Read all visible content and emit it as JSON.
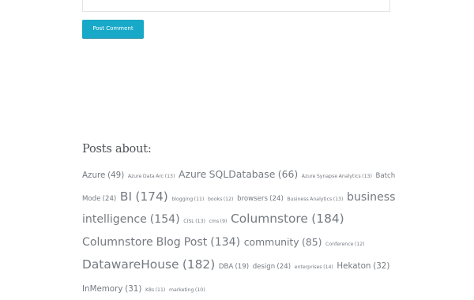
{
  "comment_form": {
    "submit_label": "Post Comment"
  },
  "posts_about": {
    "heading": "Posts about:",
    "tags": [
      {
        "text": "Azure (49)",
        "size": "t10"
      },
      {
        "text": "Azure Data Arc (13)",
        "size": "t6"
      },
      {
        "text": "Azure SQLDatabase (66)",
        "size": "t12"
      },
      {
        "text": "Azure Synapse Analytics (13)",
        "size": "t6"
      },
      {
        "text": "Batch Mode (24)",
        "size": "t9"
      },
      {
        "text": "BI (174)",
        "size": "t16"
      },
      {
        "text": "blogging (11)",
        "size": "t6"
      },
      {
        "text": "books (12)",
        "size": "t6"
      },
      {
        "text": "browsers (24)",
        "size": "t9"
      },
      {
        "text": "Business Analytics (13)",
        "size": "t6"
      },
      {
        "text": "business intelligence (154)",
        "size": "t14"
      },
      {
        "text": "CISL (13)",
        "size": "t6"
      },
      {
        "text": "cms (9)",
        "size": "t6"
      },
      {
        "text": "Columnstore (184)",
        "size": "t16"
      },
      {
        "text": "Columnstore Blog Post (134)",
        "size": "t14"
      },
      {
        "text": "community (85)",
        "size": "t12"
      },
      {
        "text": "Conference (12)",
        "size": "t6"
      },
      {
        "text": "DatawareHouse (182)",
        "size": "t16"
      },
      {
        "text": "DBA (19)",
        "size": "t9"
      },
      {
        "text": "design (24)",
        "size": "t9"
      },
      {
        "text": "enterprises (14)",
        "size": "t6"
      },
      {
        "text": "Hekaton (32)",
        "size": "t10"
      },
      {
        "text": "InMemory (31)",
        "size": "t10"
      },
      {
        "text": "K8s (11)",
        "size": "t6"
      },
      {
        "text": "marketing (10)",
        "size": "t6"
      }
    ]
  }
}
